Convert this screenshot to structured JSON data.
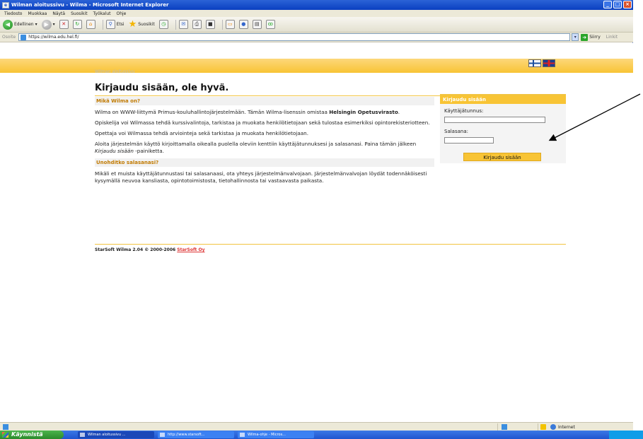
{
  "window": {
    "title": "Wilman aloitussivu - Wilma - Microsoft Internet Explorer"
  },
  "menu": [
    "Tiedosto",
    "Muokkaa",
    "Näytä",
    "Suosikit",
    "Työkalut",
    "Ohje"
  ],
  "toolbar": {
    "back_label": "Edellinen",
    "search_label": "Etsi",
    "favorites_label": "Suosikit"
  },
  "addressbar": {
    "label": "Osoite",
    "url": "https://wilma.edu.hel.fi/",
    "go_label": "Siirry",
    "links_label": "Linkit"
  },
  "page": {
    "breadcrumb": "Wilman aloitussivu",
    "title": "Kirjaudu sisään, ole hyvä.",
    "section1_title": "Mikä Wilma on?",
    "p1_text": "Wilma on WWW-liittymä Primus-kouluhallintojärjestelmään. Tämän Wilma-lisenssin omistaa ",
    "p1_bold": "Helsingin Opetusvirasto",
    "p1_end": ".",
    "p2": "Opiskelija voi Wilmassa tehdä kurssivalintoja, tarkistaa ja muokata henkilötietojaan sekä tulostaa esimerkiksi opintorekisteriotteen.",
    "p3": "Opettaja voi Wilmassa tehdä arviointeja sekä tarkistaa ja muokata henkilötietojaan.",
    "p4_text": "Aloita järjestelmän käyttö kirjoittamalla oikealla puolella oleviin kenttiin käyttäjätunnuksesi ja salasanasi. Paina tämän jälkeen ",
    "p4_italic": "Kirjaudu sisään",
    "p4_end": " -painiketta.",
    "section2_title": "Unohditko salasanasi?",
    "p5": "Mikäli et muista käyttäjätunnustasi tai salasanaasi, ota yhteys järjestelmänvalvojaan. Järjestelmänvalvojan löydät todennäköisesti kysymällä neuvoa kansliasta, opintotoimistosta, tietohallinnosta tai vastaavasta paikasta.",
    "footer_text": "StarSoft Wilma 2.04 © 2000-2006 ",
    "footer_link": "StarSoft Oy"
  },
  "login": {
    "header": "Kirjaudu sisään",
    "username_label": "Käyttäjätunnus:",
    "password_label": "Salasana:",
    "button_label": "Kirjaudu sisään"
  },
  "statusbar": {
    "zone": "Internet"
  },
  "taskbar": {
    "start_label": "Käynnistä",
    "tasks": [
      "Wilman aloitussivu ...",
      "http://www.starsoft...",
      "Wilma-ohje - Micros..."
    ]
  },
  "colors": {
    "accent_yellow": "#f8c435",
    "section_orange": "#c17a00",
    "title_blue": "#0a3fc0"
  }
}
